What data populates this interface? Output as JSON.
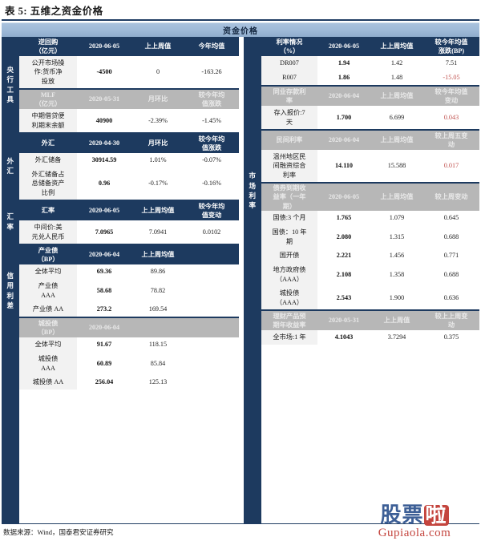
{
  "caption": "表 5: 五维之资金价格",
  "banner_title": "资金价格",
  "source": "数据来源：Wind，国泰君安证券研究",
  "watermark": {
    "cn_a": "股票",
    "cn_b": "啦",
    "en": "Gupiaola.com"
  },
  "colors": {
    "header_dark": "#1d3a5f",
    "header_gray": "#b7b7b7",
    "banner": "#9fbad8",
    "label_bg": "#f2f2f2",
    "red": "#c0504d"
  },
  "left": {
    "groups": [
      {
        "name": "央行工具",
        "chars": [
          "央",
          "行",
          "工",
          "具"
        ]
      },
      {
        "name": "外汇",
        "chars": [
          "外",
          "汇"
        ]
      },
      {
        "name": "汇率",
        "chars": [
          "汇",
          "率"
        ]
      },
      {
        "name": "信用利差",
        "chars": [
          "信",
          "用",
          "利",
          "差"
        ]
      }
    ],
    "blocks": [
      {
        "style": "dark",
        "header": [
          "逆回购\n（亿元）",
          "2020-06-05",
          "上上周值",
          "今年均值"
        ],
        "header_lines": [
          [
            "逆回购",
            "（亿元）"
          ],
          [
            "2020-06-05"
          ],
          [
            "上上周值"
          ],
          [
            "今年均值"
          ]
        ],
        "rows": [
          {
            "label_lines": [
              "公开市场操",
              "作:货币净",
              "投放"
            ],
            "values": [
              "-4500",
              "0",
              "-163.26"
            ]
          }
        ]
      },
      {
        "style": "gray",
        "header_lines": [
          [
            "MLF",
            "（亿元）"
          ],
          [
            "2020-05-31"
          ],
          [
            "月环比"
          ],
          [
            "较今年均",
            "值涨跌"
          ]
        ],
        "rows": [
          {
            "label_lines": [
              "中期借贷便",
              "利期末余额"
            ],
            "values": [
              "40900",
              "-2.39%",
              "-1.45%"
            ]
          }
        ]
      },
      {
        "style": "dark",
        "header_lines": [
          [
            "外汇"
          ],
          [
            "2020-04-30"
          ],
          [
            "月环比"
          ],
          [
            "较今年均",
            "值涨跌"
          ]
        ],
        "rows": [
          {
            "label_lines": [
              "外汇储备"
            ],
            "values": [
              "30914.59",
              "1.01%",
              "-0.07%"
            ]
          },
          {
            "label_lines": [
              "外汇储备占",
              "总储备资产",
              "比例"
            ],
            "values": [
              "0.96",
              "-0.17%",
              "-0.16%"
            ]
          }
        ]
      },
      {
        "style": "dark",
        "header_lines": [
          [
            "汇率"
          ],
          [
            "2020-06-05"
          ],
          [
            "上上周均值"
          ],
          [
            "较今年均",
            "值变动"
          ]
        ],
        "rows": [
          {
            "label_lines": [
              "中间价:美",
              "元兑人民币"
            ],
            "values": [
              "7.0965",
              "7.0941",
              "0.0102"
            ]
          }
        ]
      },
      {
        "style": "dark",
        "header_lines": [
          [
            "产业债",
            "（BP）"
          ],
          [
            "2020-06-04"
          ],
          [
            "上上周均值"
          ],
          [
            ""
          ]
        ],
        "rows": [
          {
            "label_lines": [
              "全体平均"
            ],
            "values": [
              "69.36",
              "89.86",
              ""
            ]
          },
          {
            "label_lines": [
              "产业债",
              "AAA"
            ],
            "values": [
              "58.68",
              "78.82",
              ""
            ]
          },
          {
            "label_lines": [
              "产业债 AA"
            ],
            "values": [
              "273.2",
              "169.54",
              ""
            ]
          }
        ]
      },
      {
        "style": "gray",
        "header_lines": [
          [
            "城投债",
            "（BP）"
          ],
          [
            "2020-06-04"
          ],
          [
            ""
          ],
          [
            ""
          ]
        ],
        "rows": [
          {
            "label_lines": [
              "全体平均"
            ],
            "values": [
              "91.67",
              "118.15",
              ""
            ]
          },
          {
            "label_lines": [
              "城投债",
              "AAA"
            ],
            "values": [
              "60.89",
              "85.84",
              ""
            ]
          },
          {
            "label_lines": [
              "城投债 AA"
            ],
            "values": [
              "256.04",
              "125.13",
              ""
            ]
          }
        ]
      }
    ]
  },
  "right": {
    "groups": [
      {
        "name": "市场利率",
        "chars": [
          "市",
          "场",
          "利",
          "率"
        ]
      }
    ],
    "blocks": [
      {
        "style": "dark",
        "header_lines": [
          [
            "利率情况",
            "（%）"
          ],
          [
            "2020-06-05"
          ],
          [
            "上上周均值"
          ],
          [
            "较今年均值",
            "涨跌(BP)"
          ]
        ],
        "rows": [
          {
            "label_lines": [
              "DR007"
            ],
            "values": [
              "1.94",
              "1.42",
              "7.51"
            ],
            "v3_red": false
          },
          {
            "label_lines": [
              "R007"
            ],
            "values": [
              "1.86",
              "1.48",
              "-15.05"
            ],
            "v3_red": true
          }
        ]
      },
      {
        "style": "gray",
        "header_lines": [
          [
            "同业存款利",
            "率"
          ],
          [
            "2020-06-04"
          ],
          [
            "上上周均值"
          ],
          [
            "较今年均值",
            "变动"
          ]
        ],
        "rows": [
          {
            "label_lines": [
              "存入报价:7",
              "天"
            ],
            "values": [
              "1.700",
              "6.699",
              "0.043"
            ],
            "v3_red": true
          }
        ]
      },
      {
        "style": "gray",
        "header_lines": [
          [
            "民间利率"
          ],
          [
            "2020-06-04"
          ],
          [
            "上上周均值"
          ],
          [
            "较上周五变",
            "动"
          ]
        ],
        "rows": [
          {
            "label_lines": [
              "温州地区民",
              "间融资综合",
              "利率"
            ],
            "values": [
              "14.110",
              "15.588",
              "0.017"
            ],
            "v3_red": true
          }
        ]
      },
      {
        "style": "gray",
        "header_lines": [
          [
            "债券到期收",
            "益率（一年",
            "期）"
          ],
          [
            "2020-06-05"
          ],
          [
            "上上周均值"
          ],
          [
            "较上周变动"
          ]
        ],
        "rows": [
          {
            "label_lines": [
              "国债:3 个月"
            ],
            "values": [
              "1.765",
              "1.079",
              "0.645"
            ],
            "v3_red": false
          },
          {
            "label_lines": [
              "国债：10 年",
              "期"
            ],
            "values": [
              "2.080",
              "1.315",
              "0.688"
            ],
            "v3_red": false
          },
          {
            "label_lines": [
              "国开债"
            ],
            "values": [
              "2.221",
              "1.456",
              "0.771"
            ],
            "v3_red": false
          },
          {
            "label_lines": [
              "地方政府债",
              "（AAA）"
            ],
            "values": [
              "2.108",
              "1.358",
              "0.688"
            ],
            "v3_red": false
          },
          {
            "label_lines": [
              "城投债",
              "（AAA）"
            ],
            "values": [
              "2.543",
              "1.900",
              "0.636"
            ],
            "v3_red": false
          }
        ]
      },
      {
        "style": "gray",
        "header_lines": [
          [
            "理财产品预",
            "期年收益率"
          ],
          [
            "2020-05-31"
          ],
          [
            "上上周值"
          ],
          [
            "较上上周变",
            "动"
          ]
        ],
        "rows": [
          {
            "label_lines": [
              "全市场:1 年"
            ],
            "values": [
              "4.1043",
              "3.7294",
              "0.375"
            ],
            "v3_red": false
          }
        ]
      }
    ]
  }
}
